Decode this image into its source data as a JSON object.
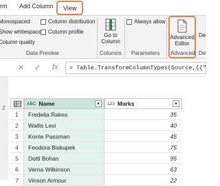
{
  "tabs": [
    {
      "label": "rm"
    },
    {
      "label": "Add Column"
    },
    {
      "label": "View"
    }
  ],
  "ribbon": {
    "checks": {
      "monospaced": "Monospaced",
      "show_whitespace": "Show whitespace",
      "column_quality": "Column quality",
      "column_distribution": "Column distribution",
      "column_profile": "Column profile",
      "always_allow": "Always allow"
    },
    "group_data_preview": "Data Preview",
    "go_to_column_1": "Go to",
    "go_to_column_2": "Column",
    "group_columns": "Columns",
    "group_parameters": "Parameters",
    "advanced_editor_1": "Advanced",
    "advanced_editor_2": "Editor",
    "group_advanced": "Advanced",
    "cut_label_1": "De",
    "cut_label_2": "De"
  },
  "formula_bar": {
    "fx": "fx",
    "text": "= Table.TransformColumnTypes(Source,{{\"Nam"
  },
  "left_pane": [
    "1",
    "2",
    "3",
    "4",
    "5",
    "6",
    "7"
  ],
  "table": {
    "columns": [
      {
        "type_icon": "ABC",
        "label": "Name"
      },
      {
        "type_icon": "123",
        "label": "Marks"
      }
    ],
    "rows": [
      {
        "num": "1",
        "name": "Fredelia Rakes",
        "marks": "35"
      },
      {
        "num": "2",
        "name": "Wallis Levi",
        "marks": "40"
      },
      {
        "num": "3",
        "name": "Korrie Passman",
        "marks": "45"
      },
      {
        "num": "4",
        "name": "Feodora Biskupek",
        "marks": "75"
      },
      {
        "num": "5",
        "name": "Dotti Bohan",
        "marks": "95"
      },
      {
        "num": "6",
        "name": "Verna Wilkinson",
        "marks": "63"
      },
      {
        "num": "7",
        "name": "Vinson Armour",
        "marks": "22"
      }
    ]
  },
  "colors": {
    "highlight": "#e0864e",
    "selected_column": "#e5f3ef",
    "accent_green": "#2e8b57"
  }
}
